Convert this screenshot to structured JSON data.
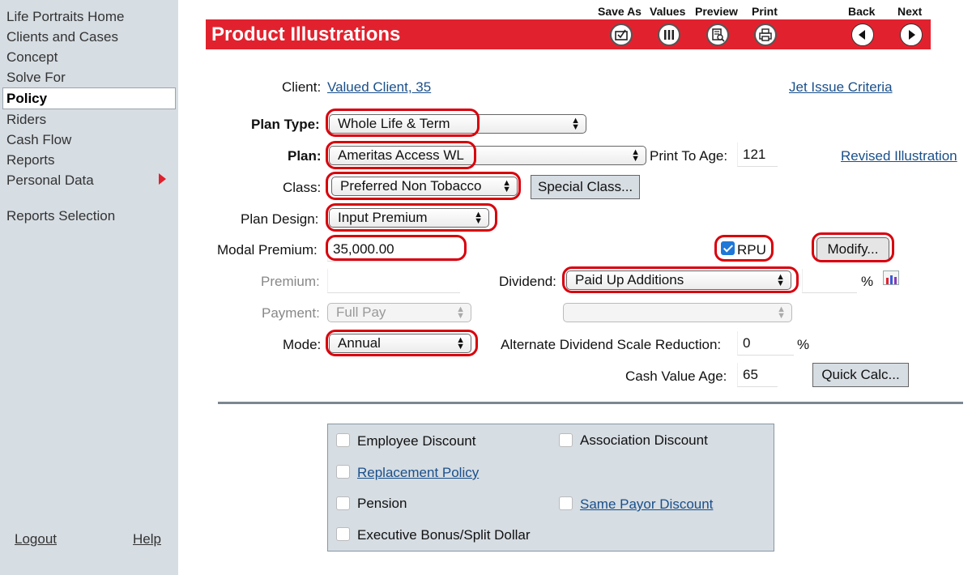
{
  "sidebar": {
    "items": [
      {
        "label": "Life Portraits Home"
      },
      {
        "label": "Clients and Cases"
      },
      {
        "label": "Concept"
      },
      {
        "label": "Solve For"
      },
      {
        "label": "Policy"
      },
      {
        "label": "Riders"
      },
      {
        "label": "Cash Flow"
      },
      {
        "label": "Reports"
      },
      {
        "label": "Personal Data"
      },
      {
        "label": "Reports Selection"
      }
    ],
    "logout": "Logout",
    "help": "Help"
  },
  "toolbar": {
    "save_as": "Save As",
    "values": "Values",
    "preview": "Preview",
    "print": "Print",
    "back": "Back",
    "next": "Next"
  },
  "banner": {
    "title": "Product Illustrations",
    "color": "#e1222e"
  },
  "form": {
    "client_label": "Client:",
    "client_value": "Valued Client, 35",
    "jet_issue": "Jet Issue Criteria",
    "plan_type_label": "Plan Type:",
    "plan_type_value": "Whole Life & Term",
    "plan_label": "Plan:",
    "plan_value": "Ameritas Access WL",
    "print_to_age_label": "Print To Age:",
    "print_to_age_value": "121",
    "revised_illustration": "Revised Illustration",
    "class_label": "Class:",
    "class_value": "Preferred Non Tobacco",
    "special_class_button": "Special Class...",
    "plan_design_label": "Plan Design:",
    "plan_design_value": "Input Premium",
    "modal_premium_label": "Modal Premium:",
    "modal_premium_value": "35,000.00",
    "rpu_label": "RPU",
    "rpu_checked": true,
    "modify_button": "Modify...",
    "premium_label": "Premium:",
    "premium_value": "",
    "dividend_label": "Dividend:",
    "dividend_value": "Paid Up Additions",
    "dividend_percent_value": "",
    "percent_sign": "%",
    "payment_label": "Payment:",
    "payment_value": "Full Pay",
    "payment_second_value": "",
    "mode_label": "Mode:",
    "mode_value": "Annual",
    "alt_dividend_label": "Alternate Dividend Scale Reduction:",
    "alt_dividend_value": "0",
    "cash_value_age_label": "Cash Value Age:",
    "cash_value_age_value": "65",
    "quick_calc_button": "Quick Calc..."
  },
  "discounts": {
    "employee": "Employee Discount",
    "association": "Association Discount",
    "replacement": "Replacement Policy",
    "pension": "Pension",
    "same_payor": "Same Payor Discount",
    "executive": "Executive Bonus/Split Dollar"
  },
  "colors": {
    "highlight": "#d8000c",
    "link": "#1a4f8a",
    "sidebar": "#d6dde3"
  }
}
